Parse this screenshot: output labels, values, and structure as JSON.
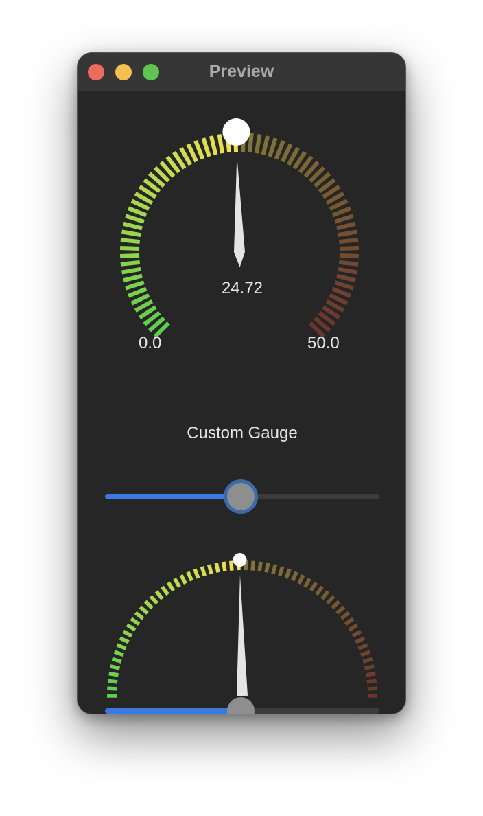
{
  "window": {
    "title": "Preview"
  },
  "gauge": {
    "value": 24.72,
    "value_text": "24.72",
    "min": 0.0,
    "max": 50.0,
    "min_label": "0.0",
    "max_label": "50.0",
    "caption": "Custom Gauge",
    "colors": {
      "start": "#5ccd4f",
      "mid": "#f1e050",
      "end": "#c14a35",
      "needle": "#e4e4e4",
      "indicator": "#ffffff"
    }
  },
  "slider_top": {
    "value": 24.72,
    "min": 0.0,
    "max": 50.0,
    "colors": {
      "fill": "#3a7ae0",
      "track": "#3b3b3b",
      "knob": "#8e8e8e"
    }
  },
  "gauge_bottom": {
    "value": 24.72,
    "min": 0.0,
    "max": 50.0
  },
  "slider_bottom": {
    "value": 24.72,
    "min": 0.0,
    "max": 50.0
  }
}
